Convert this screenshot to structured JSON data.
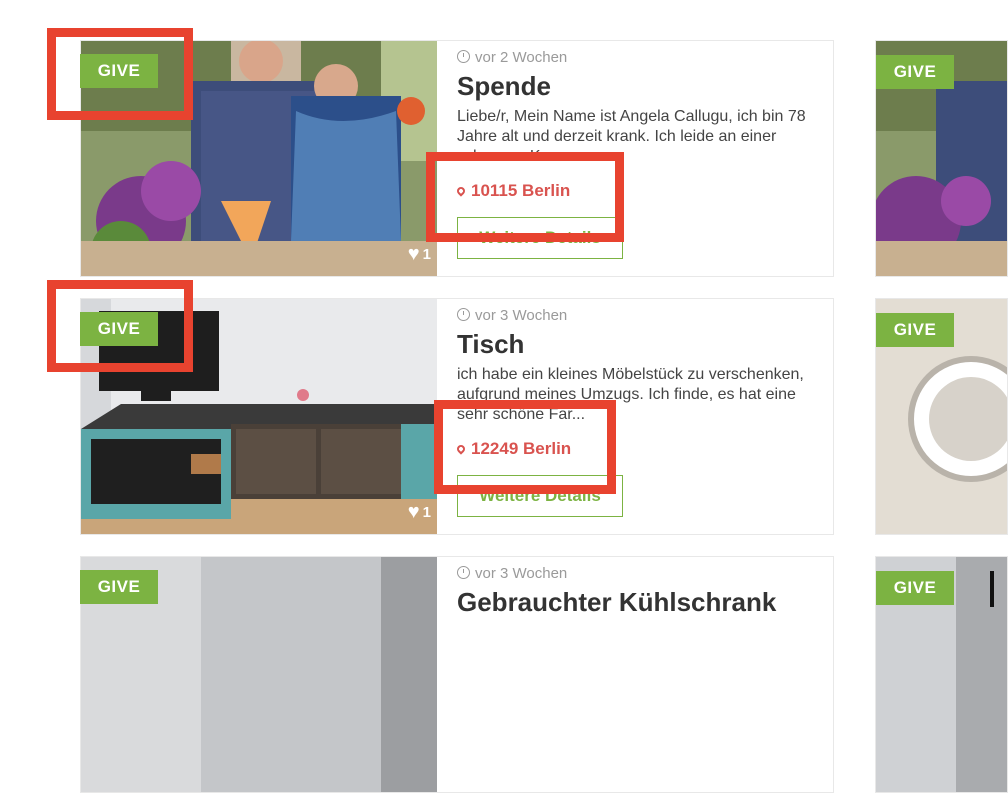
{
  "listings": [
    {
      "badge": "GIVE",
      "time": "vor 2 Wochen",
      "title": "Spende",
      "description": "Liebe/r, Mein Name ist Angela Callugu, ich bin 78 Jahre alt und derzeit krank. Ich leide an einer schweren Kr...",
      "location": "10115 Berlin",
      "likes": "1",
      "details_label": "Weitere Details"
    },
    {
      "badge": "GIVE",
      "time": "vor 3 Wochen",
      "title": "Tisch",
      "description": "ich habe ein kleines Möbelstück zu verschenken, aufgrund meines Umzugs. Ich finde, es hat eine sehr schöne Far...",
      "location": "12249 Berlin",
      "likes": "1",
      "details_label": "Weitere Details"
    },
    {
      "badge": "GIVE",
      "time": "vor 3 Wochen",
      "title": "Gebrauchter Kühlschrank"
    }
  ],
  "right_column": [
    {
      "badge": "GIVE"
    },
    {
      "badge": "GIVE"
    },
    {
      "badge": "GIVE"
    }
  ],
  "colors": {
    "badge_green": "#7cb342",
    "location_red": "#d9534f",
    "highlight_red": "#e8432f"
  }
}
